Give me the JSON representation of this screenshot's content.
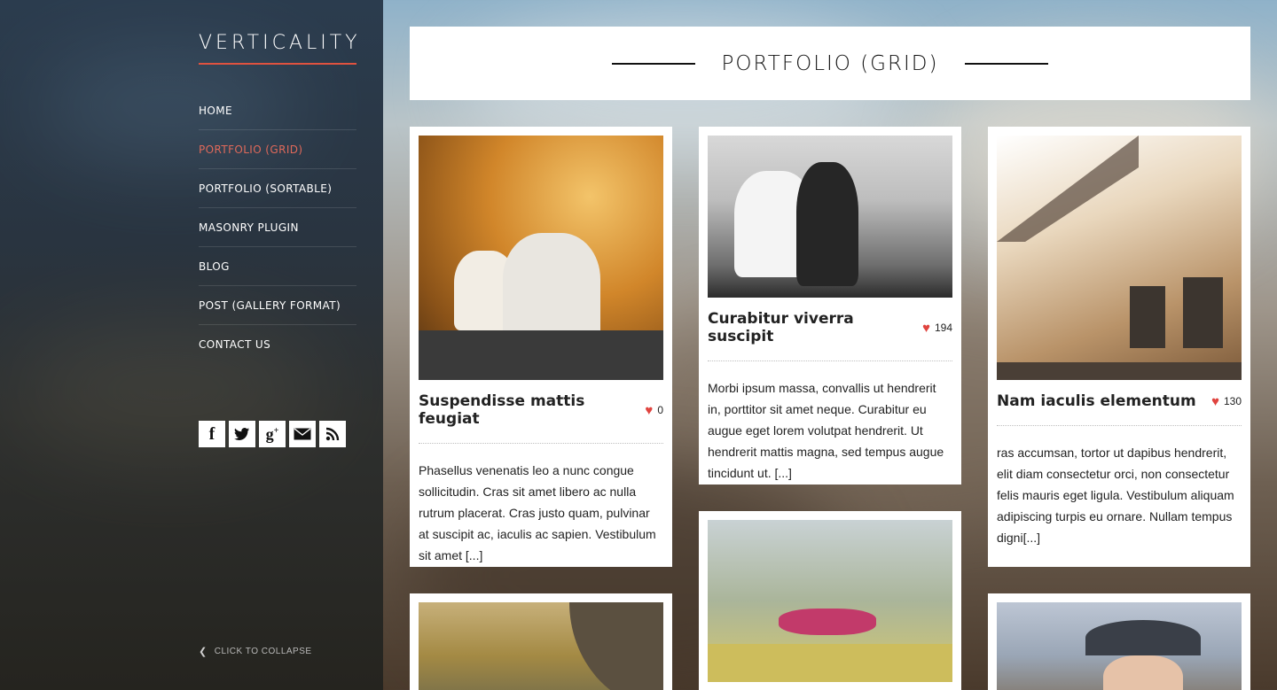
{
  "site": {
    "logo": "VERTICALITY"
  },
  "colors": {
    "accent": "#e0523f",
    "active_nav": "#e0695a",
    "heart": "#e0443f"
  },
  "nav": {
    "items": [
      {
        "label": "HOME"
      },
      {
        "label": "PORTFOLIO (GRID)"
      },
      {
        "label": "PORTFOLIO (SORTABLE)"
      },
      {
        "label": "MASONRY PLUGIN"
      },
      {
        "label": "BLOG"
      },
      {
        "label": "POST (GALLERY FORMAT)"
      },
      {
        "label": "CONTACT US"
      }
    ],
    "active": "PORTFOLIO (GRID)"
  },
  "social": {
    "icons": [
      {
        "name": "facebook-icon",
        "glyph": "f"
      },
      {
        "name": "twitter-icon",
        "glyph": "t"
      },
      {
        "name": "google-plus-icon",
        "glyph": "g+"
      },
      {
        "name": "mail-icon",
        "glyph": "✉"
      },
      {
        "name": "rss-icon",
        "glyph": "◉"
      }
    ]
  },
  "collapse": {
    "label": "CLICK TO COLLAPSE",
    "icon": "chevron-left-icon"
  },
  "page": {
    "title": "PORTFOLIO (GRID)"
  },
  "cards": [
    {
      "title": "Suspendisse mattis feugiat",
      "likes": "0",
      "excerpt": "Phasellus venenatis leo a nunc congue sollicitudin. Cras sit amet libero ac nulla rutrum placerat. Cras justo quam, pulvinar at suscipit ac, iaculis ac sapien. Vestibulum sit amet [...]"
    },
    {
      "title": "Curabitur viverra suscipit",
      "likes": "194",
      "excerpt": "Morbi ipsum massa, convallis ut hendrerit in, porttitor sit amet neque. Curabitur eu augue eget lorem volutpat hendrerit. Ut hendrerit mattis magna, sed tempus augue tincidunt ut. [...]"
    },
    {
      "title": "Nam iaculis elementum",
      "likes": "130",
      "excerpt": "ras accumsan, tortor ut dapibus hendrerit, elit diam consectetur orci, non consectetur felis mauris eget ligula. Vestibulum aliquam adipiscing turpis eu ornare. Nullam tempus digni[...]"
    }
  ]
}
